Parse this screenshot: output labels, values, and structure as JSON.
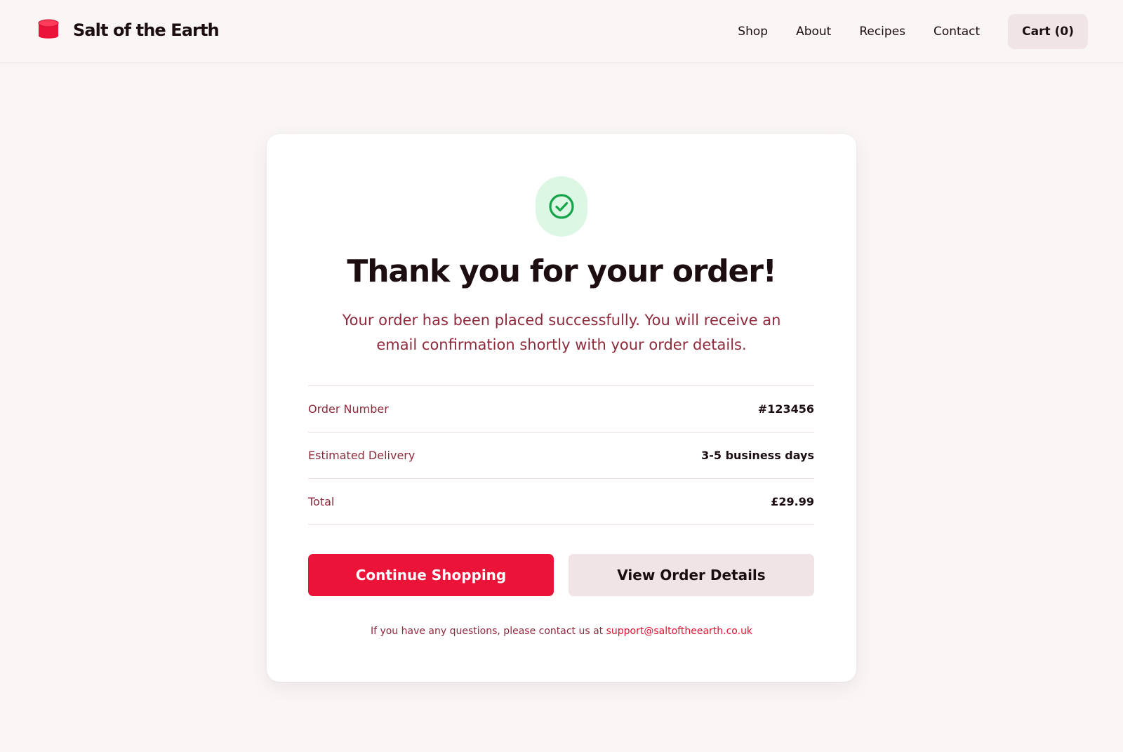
{
  "header": {
    "brand_name": "Salt of the Earth",
    "brand_icon": "salt-tin-icon",
    "nav": {
      "shop": "Shop",
      "about": "About",
      "recipes": "Recipes",
      "contact": "Contact"
    },
    "cart": {
      "label": "Cart",
      "count": "(0)"
    }
  },
  "confirmation": {
    "icon": "check-circle-icon",
    "heading": "Thank you for your order!",
    "message": "Your order has been placed successfully. You will receive an email confirmation shortly with your order details.",
    "details": [
      {
        "label": "Order Number",
        "value": "#123456"
      },
      {
        "label": "Estimated Delivery",
        "value": "3-5 business days"
      },
      {
        "label": "Total",
        "value": "£29.99"
      }
    ],
    "buttons": {
      "continue": "Continue Shopping",
      "view_details": "View Order Details"
    },
    "support": {
      "text": "If you have any questions, please contact us at ",
      "email": "support@saltoftheearth.co.uk"
    }
  },
  "colors": {
    "accent": "#eb1337",
    "muted_text": "#8e2a3c",
    "success_bg": "#dcf7e4",
    "success_icon": "#16a34a",
    "page_bg": "#faf6f6",
    "secondary_button_bg": "#f1e4e6"
  }
}
